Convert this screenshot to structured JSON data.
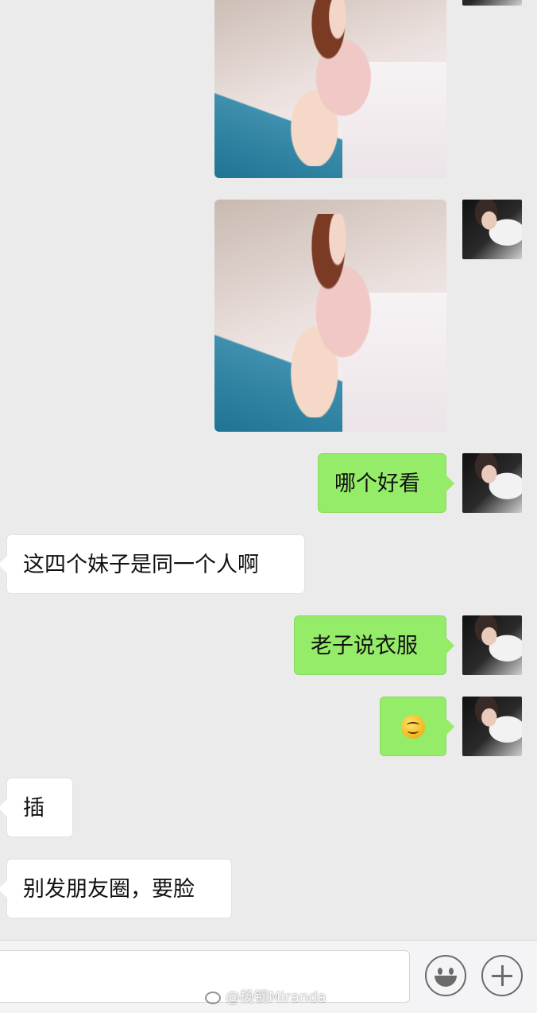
{
  "messages": [
    {
      "type": "image",
      "side": "right",
      "description": "photo"
    },
    {
      "type": "image",
      "side": "right",
      "description": "photo"
    },
    {
      "type": "text",
      "side": "right",
      "text": "哪个好看"
    },
    {
      "type": "text",
      "side": "left",
      "text": "这四个妹子是同一个人啊"
    },
    {
      "type": "text",
      "side": "right",
      "text": "老子说衣服"
    },
    {
      "type": "emoji",
      "side": "right",
      "emoji": "smile-emoji"
    },
    {
      "type": "text",
      "side": "left",
      "text": "插"
    },
    {
      "type": "text",
      "side": "left",
      "text": "别发朋友圈，要脸"
    }
  ],
  "input_bar": {
    "emoji_button_icon": "smile-icon",
    "more_button_icon": "plus-icon"
  },
  "watermark": {
    "text": "@杨钢Miranda"
  },
  "colors": {
    "sent_bubble": "#95ec69",
    "received_bubble": "#ffffff",
    "chat_background": "#ebebeb"
  }
}
